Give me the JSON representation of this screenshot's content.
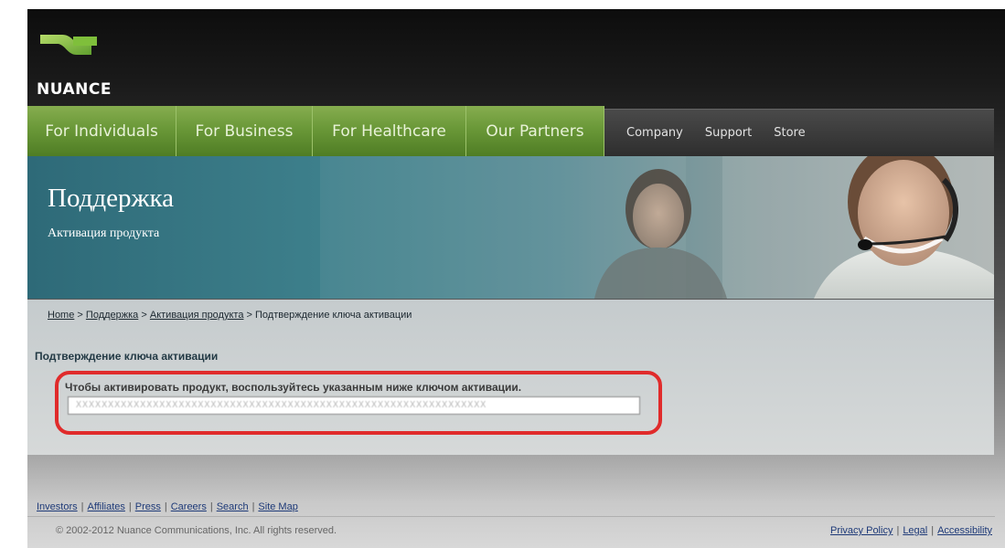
{
  "logo": {
    "name": "NUANCE"
  },
  "nav": {
    "primary": [
      {
        "label": "For Individuals"
      },
      {
        "label": "For Business"
      },
      {
        "label": "For Healthcare"
      },
      {
        "label": "Our Partners"
      }
    ],
    "secondary": [
      {
        "label": "Company"
      },
      {
        "label": "Support"
      },
      {
        "label": "Store"
      }
    ]
  },
  "banner": {
    "title": "Поддержка",
    "subtitle": "Активация продукта"
  },
  "breadcrumb": {
    "home": "Home",
    "sep": ">",
    "support": "Поддержка",
    "activation": "Активация продукта",
    "current": "Подтверждение ключа активации"
  },
  "main": {
    "section_title": "Подтверждение ключа активации",
    "instruction": "Чтобы активировать продукт, воспользуйтесь указанным ниже ключом активации.",
    "activation_key": "XXXXXXXXXXXXXXXXXXXXXXXXXXXXXXXXXXXXXXXXXXXXXXXXXXXXXXXXXXXXXXXX"
  },
  "footer": {
    "links": [
      {
        "label": "Investors"
      },
      {
        "label": "Affiliates"
      },
      {
        "label": "Press"
      },
      {
        "label": "Careers"
      },
      {
        "label": "Search"
      },
      {
        "label": "Site Map"
      }
    ],
    "link_sep": "|",
    "copyright": "© 2002-2012 Nuance Communications, Inc. All rights reserved.",
    "right_links": [
      {
        "label": "Privacy Policy"
      },
      {
        "label": "Legal"
      },
      {
        "label": "Accessibility"
      }
    ]
  },
  "colors": {
    "nav_green": "#6a9838",
    "banner_teal": "#2e6a78",
    "highlight_red": "#e02b2b",
    "link_blue": "#1e3a78"
  },
  "icons": {
    "logo_mark": "nuance-logo-icon",
    "support_agent": "support-agent-photo",
    "woman_photo": "woman-photo"
  }
}
